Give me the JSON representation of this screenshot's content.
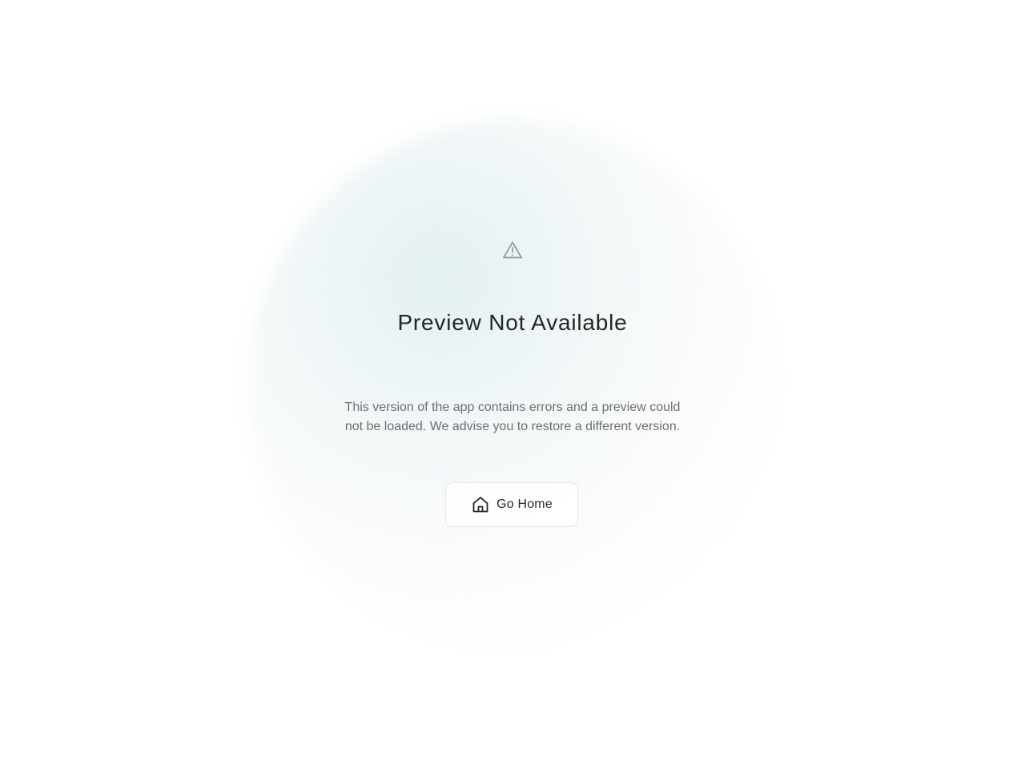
{
  "error": {
    "icon": "warning-triangle-icon",
    "title": "Preview Not Available",
    "description": "This version of the app contains errors and a preview could not be loaded. We advise you to restore a different version."
  },
  "actions": {
    "go_home_label": "Go Home",
    "go_home_icon": "home-icon"
  },
  "colors": {
    "background": "#ffffff",
    "glow": "#e2eff2",
    "title": "#262626",
    "description": "#6f6f6f",
    "button_border": "#e6e6e6"
  }
}
